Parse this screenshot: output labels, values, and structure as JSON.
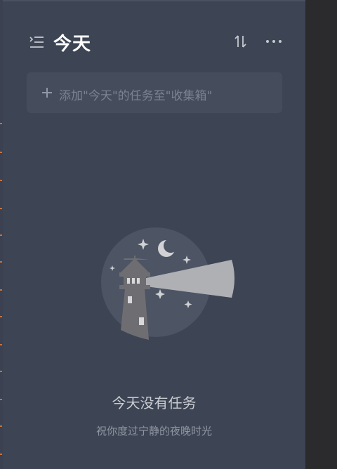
{
  "header": {
    "title": "今天",
    "menu_icon": "list-collapse-icon",
    "sort_icon": "sort-arrows-icon",
    "more_icon": "more-horizontal-icon"
  },
  "add_task": {
    "icon": "plus-icon",
    "placeholder": "添加\"今天\"的任务至\"收集箱\""
  },
  "empty_state": {
    "illustration": "lighthouse-night-illustration",
    "title": "今天没有任务",
    "subtitle": "祝你度过宁静的夜晚时光"
  },
  "colors": {
    "panel_bg": "#3d4453",
    "input_bg": "#454c5b",
    "title_text": "#ffffff",
    "empty_title": "#c9ccd2",
    "empty_subtitle": "#8f95a2",
    "accent_tick": "#c7733a"
  }
}
